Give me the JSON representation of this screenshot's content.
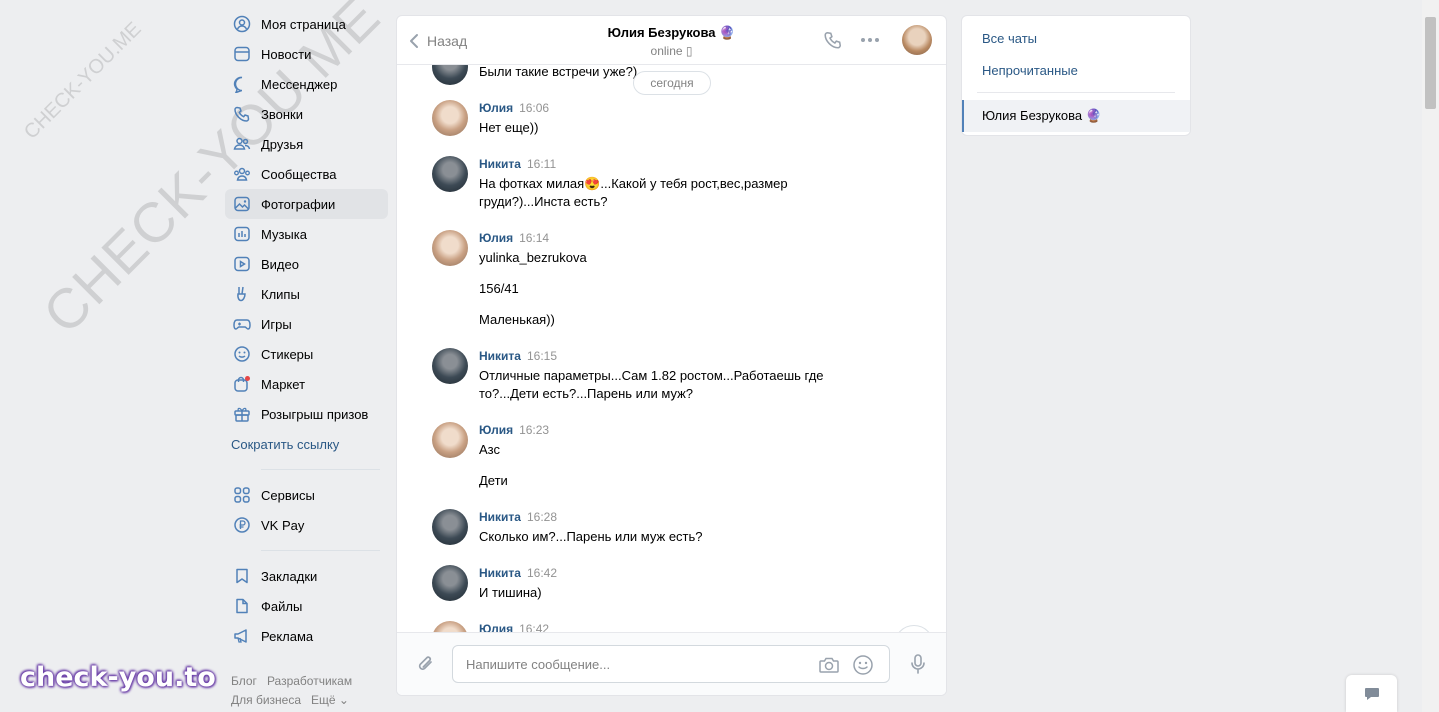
{
  "watermarks": {
    "small": "CHECK-YOU.ME",
    "large": "CHECK-YOU.ME",
    "logo": "check-you.to"
  },
  "nav": {
    "items": [
      {
        "label": "Моя страница",
        "icon": "user-circle-icon"
      },
      {
        "label": "Новости",
        "icon": "news-icon"
      },
      {
        "label": "Мессенджер",
        "icon": "message-icon"
      },
      {
        "label": "Звонки",
        "icon": "phone-icon"
      },
      {
        "label": "Друзья",
        "icon": "friends-icon"
      },
      {
        "label": "Сообщества",
        "icon": "communities-icon"
      },
      {
        "label": "Фотографии",
        "icon": "photo-icon",
        "active": true
      },
      {
        "label": "Музыка",
        "icon": "music-icon"
      },
      {
        "label": "Видео",
        "icon": "video-icon"
      },
      {
        "label": "Клипы",
        "icon": "clips-icon"
      },
      {
        "label": "Игры",
        "icon": "gamepad-icon"
      },
      {
        "label": "Стикеры",
        "icon": "smile-icon"
      },
      {
        "label": "Маркет",
        "icon": "market-icon"
      },
      {
        "label": "Розыгрыш призов",
        "icon": "gift-icon"
      }
    ],
    "shorten_link": "Сократить ссылку",
    "services": [
      {
        "label": "Сервисы",
        "icon": "services-icon"
      },
      {
        "label": "VK Pay",
        "icon": "vkpay-icon"
      }
    ],
    "extra": [
      {
        "label": "Закладки",
        "icon": "bookmark-icon"
      },
      {
        "label": "Файлы",
        "icon": "file-icon"
      },
      {
        "label": "Реклама",
        "icon": "megaphone-icon"
      }
    ],
    "footer": {
      "blog": "Блог",
      "developers": "Разработчикам",
      "business": "Для бизнеса",
      "more": "Ещё ⌄"
    }
  },
  "chat": {
    "back": "Назад",
    "peer_name": "Юлия Безрукова 🔮",
    "peer_status": "online ▯",
    "date_pill": "сегодня",
    "partial_top_text": "Были такие встречи уже?)",
    "messages": [
      {
        "author": "Юлия",
        "time": "16:06",
        "lines": [
          "Нет еще))"
        ]
      },
      {
        "author": "Никита",
        "time": "16:11",
        "lines": [
          "На фотках милая😍...Какой у тебя рост,вес,размер груди?)...Инста есть?"
        ]
      },
      {
        "author": "Юлия",
        "time": "16:14",
        "lines": [
          "yulinka_bezrukova",
          "156/41",
          "Маленькая))"
        ]
      },
      {
        "author": "Никита",
        "time": "16:15",
        "lines": [
          "Отличные параметры...Сам 1.82 ростом...Работаешь где то?...Дети есть?...Парень или муж?"
        ]
      },
      {
        "author": "Юлия",
        "time": "16:23",
        "lines": [
          "Азс",
          "Дети"
        ]
      },
      {
        "author": "Никита",
        "time": "16:28",
        "lines": [
          "Сколько им?...Парень или муж есть?"
        ]
      },
      {
        "author": "Никита",
        "time": "16:42",
        "lines": [
          "И тишина)"
        ]
      },
      {
        "author": "Юлия",
        "time": "16:42",
        "lines": []
      }
    ],
    "composer_placeholder": "Напишите сообщение..."
  },
  "rightpanel": {
    "all_chats": "Все чаты",
    "unread": "Непрочитанные",
    "active_chat": "Юлия Безрукова 🔮"
  },
  "colors": {
    "link": "#2a5885",
    "accent": "#5181b8",
    "bg": "#edeef0"
  }
}
